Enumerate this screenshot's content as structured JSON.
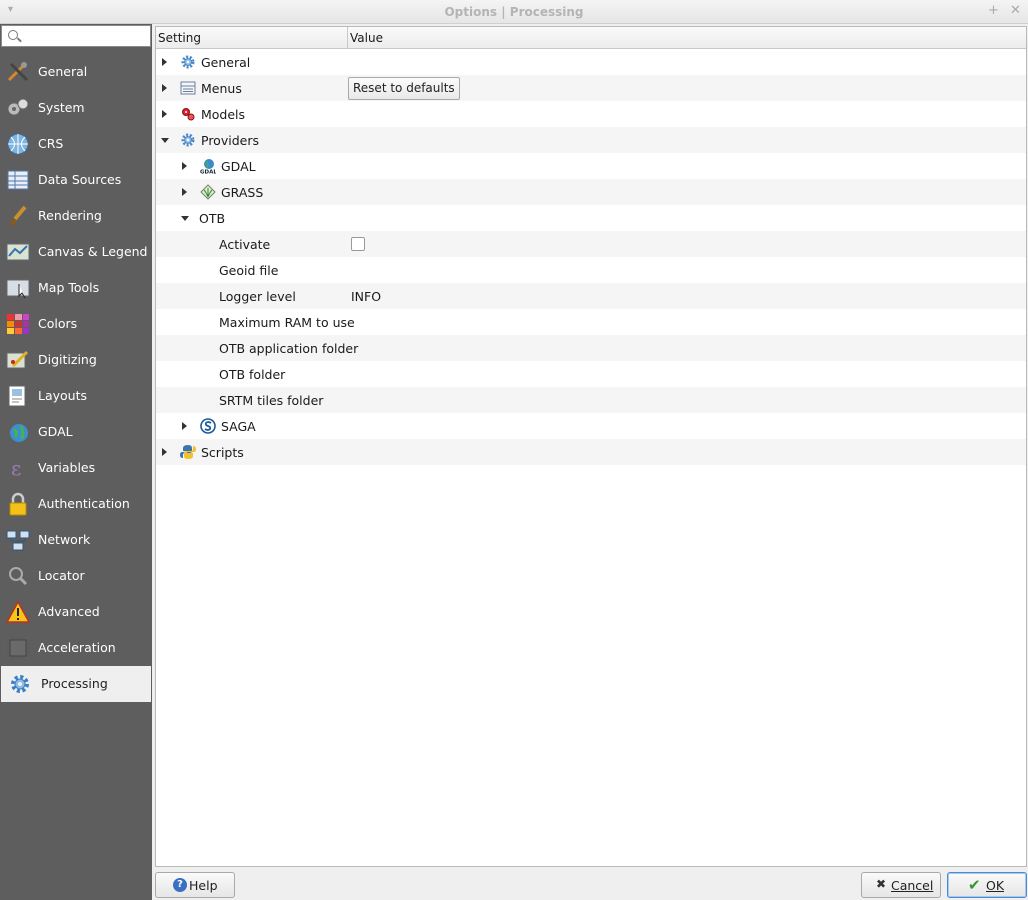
{
  "window": {
    "title": "Options | Processing"
  },
  "sidebar": {
    "search_placeholder": "",
    "items": [
      {
        "label": "General",
        "icon": "tools-icon"
      },
      {
        "label": "System",
        "icon": "gears-icon"
      },
      {
        "label": "CRS",
        "icon": "globe-grid-icon"
      },
      {
        "label": "Data Sources",
        "icon": "table-icon"
      },
      {
        "label": "Rendering",
        "icon": "paintbrush-icon"
      },
      {
        "label": "Canvas & Legend",
        "icon": "map-canvas-icon"
      },
      {
        "label": "Map Tools",
        "icon": "map-cursor-icon"
      },
      {
        "label": "Colors",
        "icon": "color-grid-icon"
      },
      {
        "label": "Digitizing",
        "icon": "digitize-pencil-icon"
      },
      {
        "label": "Layouts",
        "icon": "layout-icon"
      },
      {
        "label": "GDAL",
        "icon": "gdal-globe-icon"
      },
      {
        "label": "Variables",
        "icon": "epsilon-icon"
      },
      {
        "label": "Authentication",
        "icon": "padlock-icon"
      },
      {
        "label": "Network",
        "icon": "network-icon"
      },
      {
        "label": "Locator",
        "icon": "magnifier-icon"
      },
      {
        "label": "Advanced",
        "icon": "warning-icon"
      },
      {
        "label": "Acceleration",
        "icon": "chip-icon"
      },
      {
        "label": "Processing",
        "icon": "gear-icon"
      }
    ],
    "active": "Processing"
  },
  "tree": {
    "headers": {
      "setting": "Setting",
      "value": "Value"
    },
    "rows": [
      {
        "label": "General",
        "level": 0,
        "expander": "collapsed",
        "icon": "gear-icon"
      },
      {
        "label": "Menus",
        "level": 0,
        "expander": "collapsed",
        "icon": "menu-icon",
        "button": "Reset to defaults"
      },
      {
        "label": "Models",
        "level": 0,
        "expander": "collapsed",
        "icon": "models-icon"
      },
      {
        "label": "Providers",
        "level": 0,
        "expander": "expanded",
        "icon": "gear-icon"
      },
      {
        "label": "GDAL",
        "level": 1,
        "expander": "collapsed",
        "icon": "gdal-icon"
      },
      {
        "label": "GRASS",
        "level": 1,
        "expander": "collapsed",
        "icon": "grass-icon"
      },
      {
        "label": "OTB",
        "level": 1,
        "expander": "expanded",
        "icon": ""
      },
      {
        "label": "Activate",
        "level": 2,
        "checkbox": false
      },
      {
        "label": "Geoid file",
        "level": 2,
        "value": ""
      },
      {
        "label": "Logger level",
        "level": 2,
        "value": "INFO"
      },
      {
        "label": "Maximum RAM to use",
        "level": 2,
        "value": ""
      },
      {
        "label": "OTB application folder",
        "level": 2,
        "value": ""
      },
      {
        "label": "OTB folder",
        "level": 2,
        "value": ""
      },
      {
        "label": "SRTM tiles folder",
        "level": 2,
        "value": ""
      },
      {
        "label": "SAGA",
        "level": 1,
        "expander": "collapsed",
        "icon": "saga-icon"
      },
      {
        "label": "Scripts",
        "level": 0,
        "expander": "collapsed",
        "icon": "python-icon"
      }
    ]
  },
  "buttons": {
    "help": "Help",
    "cancel": "Cancel",
    "ok": "OK"
  }
}
